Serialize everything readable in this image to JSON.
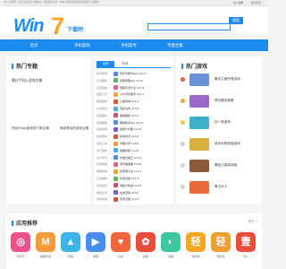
{
  "topbar": {
    "notice": "Win7下载吧，专业正版系统下载站点，欢迎您的访问！本站为您提供最新系统及软件下载服务",
    "link1": "加入收藏",
    "link2": "设为首页"
  },
  "header": {
    "logo_prefix": "Win",
    "logo_seven": "7",
    "logo_suffix": "下载吧",
    "logo_url": "WWW.WIN7XZB.COM",
    "search_placeholder": "",
    "search_button": "搜索"
  },
  "nav": {
    "items": [
      "首页",
      "手机游戏",
      "手机软件",
      "专题合集"
    ]
  },
  "left_panel": {
    "title": "热门专题",
    "links": [
      "最红手机心游戏合集",
      "同步乐app使用发下载合集",
      "养我类似的游戏合集"
    ]
  },
  "middle_panel": {
    "tabs": [
      "全部",
      "游戏"
    ],
    "rows": [
      {
        "category": "教育教学",
        "name": "同步乐教育app v4.2.1",
        "color": "#4a8cf0"
      },
      {
        "category": "生活服务",
        "name": "智能家居app v1.2.3",
        "color": "#5cb85c"
      },
      {
        "category": "影音播放",
        "name": "视频高清大全 v3.0.4",
        "color": "#e85c8a"
      },
      {
        "category": "便捷工具",
        "name": "小叶手机助手 v2.0.7",
        "color": "#f5a623"
      },
      {
        "category": "网络购物",
        "name": "小鹿商城 v5.1.2",
        "color": "#e94e3c"
      },
      {
        "category": "社交聊天",
        "name": "轻松交友 v1.5.8",
        "color": "#3cb4e8"
      },
      {
        "category": "拍照美化",
        "name": "美颜相机 v6.0.1",
        "color": "#e0427a"
      },
      {
        "category": "金融理财",
        "name": "理财助手app v2.1.0",
        "color": "#4a8cf0"
      },
      {
        "category": "运动健康",
        "name": "健康计步器 v3.3.9",
        "color": "#7a5cd6"
      },
      {
        "category": "新闻阅读",
        "name": "新闻资讯 v4.0.2",
        "color": "#e94e3c"
      },
      {
        "category": "系统工具",
        "name": "清理大师 v1.8.5",
        "color": "#f59b3a"
      },
      {
        "category": "出行导航",
        "name": "地图导航 v7.2.0",
        "color": "#3cb4e8"
      },
      {
        "category": "办公学习",
        "name": "文档扫描王 v2.4.3",
        "color": "#4a8cf0"
      },
      {
        "category": "影音播放",
        "name": "音乐播放器 v5.0.6",
        "color": "#e85c8a"
      },
      {
        "category": "网络购物",
        "name": "优惠券大全 v1.2.1",
        "color": "#f5a623"
      },
      {
        "category": "生活服务",
        "name": "外卖点餐 v3.1.4",
        "color": "#5cb85c"
      },
      {
        "category": "休闲益智",
        "name": "消除大作战 v1.0.9",
        "color": "#e0427a"
      },
      {
        "category": "角色扮演",
        "name": "仙侠奇缘 v2.6.0",
        "color": "#7a5cd6"
      },
      {
        "category": "动作冒险",
        "name": "勇者无敌 v1.3.3",
        "color": "#e94e3c"
      }
    ]
  },
  "right_panel": {
    "title": "热门游戏",
    "items": [
      {
        "name": "魔法之家所有游戏",
        "color": "#6a8fd8"
      },
      {
        "name": "梦幻魔法城堡",
        "color": "#9a6ac8"
      },
      {
        "name": "加一秀游戏",
        "color": "#3cb0c8"
      },
      {
        "name": "成为你的老板游戏",
        "color": "#d8b040"
      },
      {
        "name": "牌品之城游戏版",
        "color": "#8a5a3a"
      },
      {
        "name": "警卫大人",
        "color": "#e86a3a"
      }
    ]
  },
  "bottom_panel": {
    "title": "应用推荐",
    "more": "更多 >",
    "apps": [
      {
        "glyph": "◎",
        "label": "同步乐",
        "color": "#f0508a"
      },
      {
        "glyph": "M",
        "label": "美团外卖",
        "color": "#f59b3a"
      },
      {
        "glyph": "▲",
        "label": "导航",
        "color": "#3cb4e8"
      },
      {
        "glyph": "▶",
        "label": "视频",
        "color": "#4a8cf0"
      },
      {
        "glyph": "♥",
        "label": "交友",
        "color": "#f0653a"
      },
      {
        "glyph": "✿",
        "label": "拍照",
        "color": "#e94e3c"
      },
      {
        "glyph": "◐",
        "label": "直播",
        "color": "#3cc8a0"
      },
      {
        "glyph": "轻",
        "label": "轻松学",
        "color": "#f5a623"
      },
      {
        "glyph": "轻",
        "label": "轻阅读",
        "color": "#f0a030"
      },
      {
        "glyph": "壹",
        "label": "壹心",
        "color": "#e94e3c"
      }
    ]
  }
}
